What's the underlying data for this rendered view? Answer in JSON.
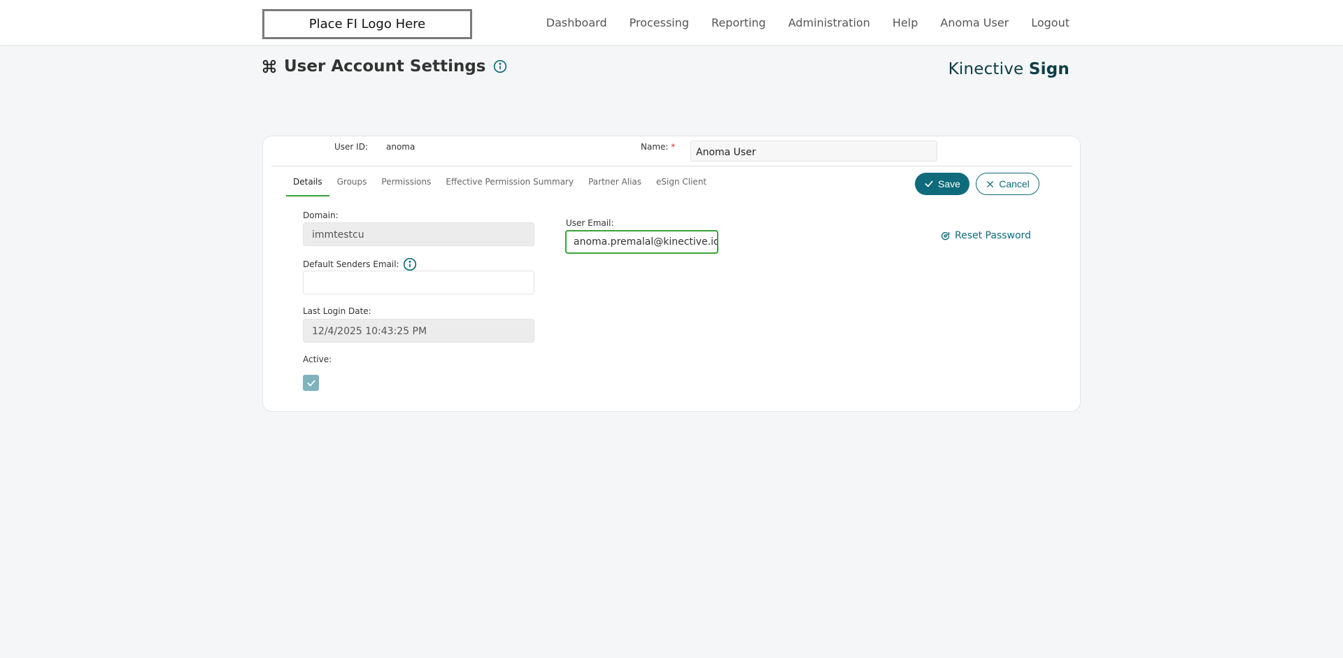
{
  "header": {
    "logo_text": "Place FI Logo Here",
    "nav": [
      "Dashboard",
      "Processing",
      "Reporting",
      "Administration",
      "Help",
      "Anoma User",
      "Logout"
    ]
  },
  "page": {
    "title": "User Account Settings",
    "brand_light": "Kinective ",
    "brand_bold": "Sign"
  },
  "user_header": {
    "user_id_label": "User ID:",
    "user_id_value": "anoma",
    "name_label": "Name:",
    "name_required_marker": "*",
    "name_value": "Anoma User"
  },
  "tabs": [
    {
      "label": "Details",
      "active": true
    },
    {
      "label": "Groups",
      "active": false
    },
    {
      "label": "Permissions",
      "active": false
    },
    {
      "label": "Effective Permission Summary",
      "active": false
    },
    {
      "label": "Partner Alias",
      "active": false
    },
    {
      "label": "eSign Client",
      "active": false
    }
  ],
  "actions": {
    "save_label": "Save",
    "cancel_label": "Cancel",
    "reset_password_label": "Reset Password"
  },
  "details": {
    "domain_label": "Domain:",
    "domain_value": "immtestcu",
    "default_senders_email_label": "Default Senders Email:",
    "default_senders_email_value": "",
    "last_login_label": "Last Login Date:",
    "last_login_value": "12/4/2025 10:43:25 PM",
    "active_label": "Active:",
    "active_checked": true,
    "user_email_label": "User Email:",
    "user_email_value": "anoma.premalal@kinective.io"
  },
  "colors": {
    "accent": "#0f6b7b",
    "focus_green": "#3aa339",
    "required": "#d32f2f"
  }
}
